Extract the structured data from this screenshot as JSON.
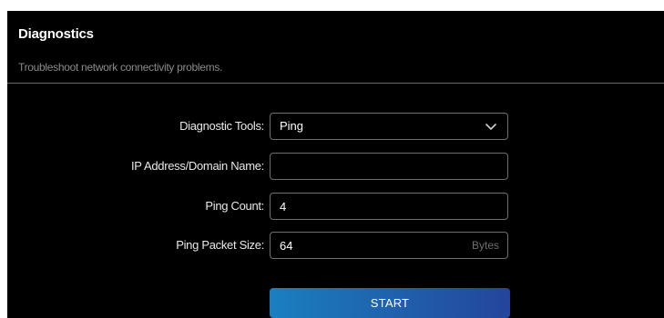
{
  "header": {
    "title": "Diagnostics",
    "subtitle": "Troubleshoot network connectivity problems."
  },
  "form": {
    "diagnostic_tool": {
      "label": "Diagnostic Tools:",
      "value": "Ping",
      "icon": "chevron-down-icon"
    },
    "address": {
      "label": "IP Address/Domain Name:",
      "value": ""
    },
    "ping_count": {
      "label": "Ping Count:",
      "value": "4"
    },
    "packet_size": {
      "label": "Ping Packet Size:",
      "value": "64",
      "unit": "Bytes"
    }
  },
  "actions": {
    "start_label": "START"
  },
  "colors": {
    "panel_background": "#000000",
    "button_gradient_start": "#1a7fc0",
    "button_gradient_end": "#24459b",
    "field_border": "#6e6e6e"
  }
}
